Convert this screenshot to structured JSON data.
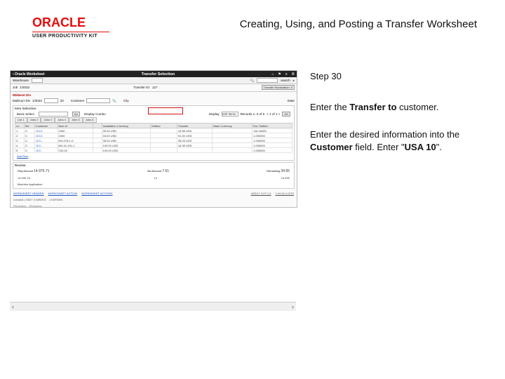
{
  "brand": {
    "name": "ORACLE",
    "subtitle": "USER PRODUCTIVITY KIT"
  },
  "doc_title": "Creating, Using, and Posting a Transfer Worksheet",
  "step": {
    "label": "Step 30"
  },
  "instructions": {
    "p1_pre": "Enter the ",
    "p1_bold": "Transfer to",
    "p1_post": " customer.",
    "p2_pre": "Enter the desired information into the ",
    "p2_bold1": "Customer",
    "p2_mid": " field. Enter \"",
    "p2_bold2": "USA 10",
    "p2_post": "\"."
  },
  "app": {
    "back": "‹ Oracle Worksheet",
    "title": "Transfer Selection",
    "icons": {
      "home": "⌂",
      "flag": "⚑",
      "grid": "≡",
      "menu": "≣"
    },
    "subbar": {
      "search_label": "search"
    },
    "filters": {
      "warehouse_label": "Warehouse",
      "warehouse_value": "2",
      "job_label": "Job",
      "job_value": "1/3033",
      "transfer_id_label": "Transfer ID:",
      "transfer_id_value": "127",
      "transfer_workstation": "Transfer Workstation: 0",
      "from_label": "Midwest Div",
      "multicurr_label1": "Multicurr Div",
      "multicurr_value1": "1/3033",
      "multicurr_val2": "33",
      "customer_label": "Customer",
      "city_label": "City",
      "state_label": "State"
    },
    "item_selection": {
      "title": "Item Selection",
      "basic_search": "Basic Select",
      "go": "Go",
      "display_combo": "Display Combo",
      "display_label": "Display",
      "display_value": "100 Items",
      "recs": "Records 1- 5 of 5",
      "nav": "< 1 of 1 >",
      "of1": "1",
      "ok": "OK",
      "tabs": [
        "List 1",
        "Jobs 2",
        "Jobs 3",
        "Jobs 4",
        "Jobs 5",
        "Jobs 6"
      ],
      "cols": [
        "Ln",
        "Sel",
        "Customer",
        "Item Id",
        "",
        "Installation Currency",
        "Settled",
        "Transfer",
        "Base Currency",
        "Est. Settled"
      ],
      "rows": [
        {
          "ln": "1",
          "sel": "☐",
          "cust": "JCC1",
          "item": "1060",
          "ic": "30.00 USD",
          "settled": "",
          "tr": "15.36 USD",
          "bc": "",
          "est": "116.16000"
        },
        {
          "ln": "2",
          "sel": "☐",
          "cust": "JCC2",
          "item": "1500",
          "ic": "03.00 USD",
          "settled": "",
          "tr": "01.00 USD",
          "bc": "",
          "est": "1.000000"
        },
        {
          "ln": "3",
          "sel": "☐",
          "cust": "JCC--",
          "item": "MV-078-1-0",
          "ic": "35.03 USD",
          "settled": "",
          "tr": "35.03 USD",
          "bc": "",
          "est": "1.000000"
        },
        {
          "ln": "4",
          "sel": "☐",
          "cust": "JCC..",
          "item": "MV-41-101-1",
          "ic": "100.00 USD",
          "settled": "",
          "tr": "18.39 USD",
          "bc": "",
          "est": "1.000000"
        },
        {
          "ln": "5",
          "sel": "☐",
          "cust": "JCC..",
          "item": "CW-02",
          "ic": "193.00 USD",
          "settled": "",
          "tr": "",
          "bc": "",
          "est": "1.000000"
        }
      ],
      "add_row": "Add Row",
      "review": "Review"
    },
    "review_block": {
      "r1l": "Req Amount",
      "r1lv": "14.975.71",
      "r1c": "3rd Amount",
      "r1cv": "7.61",
      "r1r": "Remaining",
      "r1rv": "34.95",
      "r2l": "14.940.76",
      "r2c": "14",
      "r2r": "14.932",
      "r3l": "Machine Application"
    },
    "footer_links": [
      "WORKSHEET HEADER",
      "WORKSHEET ACTION",
      "WORKSHEET ACTIONS"
    ],
    "audit": {
      "created": "Created | 03/07 3 WEEKS",
      "modified": "J KERSEN",
      "right1": "4/03/17 4:07:1.4",
      "right2": "1:04 AU LOGS"
    },
    "controls": {
      "reselect": "(Re)select",
      "reselected": "(Re)select"
    }
  }
}
